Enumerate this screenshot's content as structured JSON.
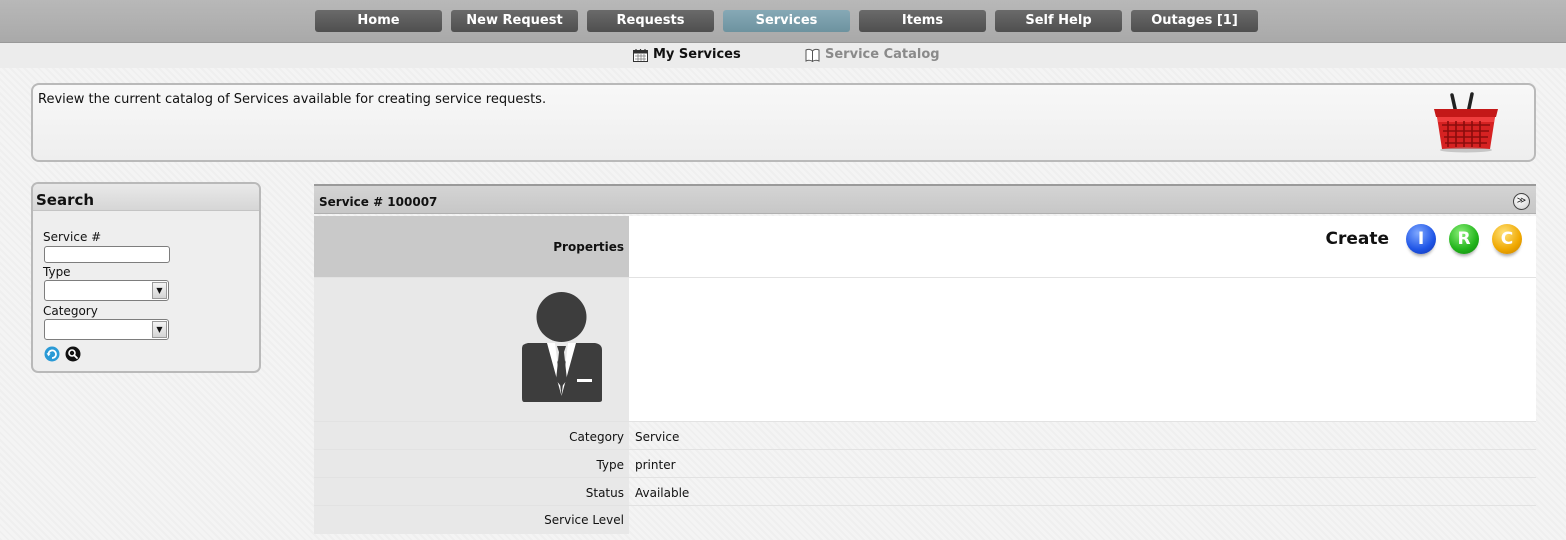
{
  "nav": {
    "items": [
      {
        "label": "Home"
      },
      {
        "label": "New Request"
      },
      {
        "label": "Requests"
      },
      {
        "label": "Services",
        "active": true
      },
      {
        "label": "Items"
      },
      {
        "label": "Self Help"
      },
      {
        "label": "Outages [1]"
      }
    ]
  },
  "subnav": {
    "my_services": "My Services",
    "service_catalog": "Service Catalog"
  },
  "info": {
    "message": "Review the current catalog of Services available for creating service requests.",
    "icon": "shopping-basket-icon"
  },
  "search": {
    "title": "Search",
    "service_no_label": "Service #",
    "service_no_value": "",
    "type_label": "Type",
    "type_value": "",
    "category_label": "Category",
    "category_value": ""
  },
  "service": {
    "title": "Service # 100007",
    "properties_label": "Properties",
    "create_label": "Create",
    "create_buttons": [
      "I",
      "R",
      "C"
    ],
    "fields": [
      {
        "label": "Category",
        "value": "Service"
      },
      {
        "label": "Type",
        "value": "printer"
      },
      {
        "label": "Status",
        "value": "Available"
      },
      {
        "label": "Service Level",
        "value": ""
      }
    ]
  },
  "colors": {
    "nav_button": "#5a5a5a",
    "nav_active": "#7aa0ad",
    "orb_i": "#1f55e6",
    "orb_r": "#21b41a",
    "orb_c": "#f0a800"
  }
}
